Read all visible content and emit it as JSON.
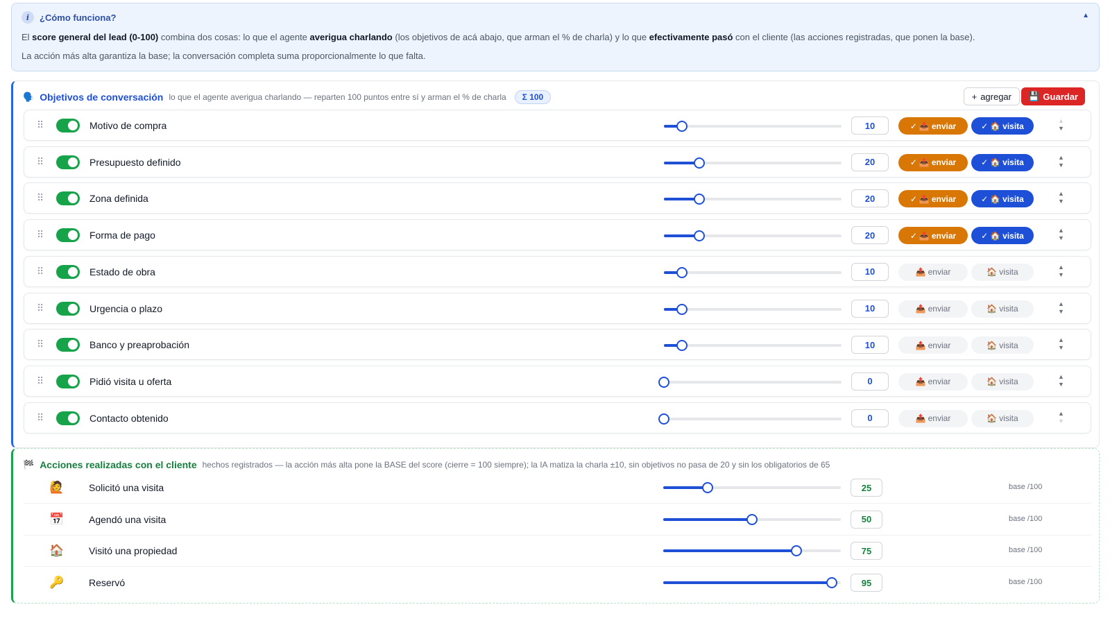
{
  "info": {
    "title": "¿Cómo funciona?",
    "line1": [
      {
        "t": "El ",
        "b": false
      },
      {
        "t": "score general del lead (0-100)",
        "b": true
      },
      {
        "t": " combina dos cosas: lo que el agente ",
        "b": false
      },
      {
        "t": "averigua charlando",
        "b": true
      },
      {
        "t": " (los objetivos de acá abajo, que arman el % de charla) y lo que ",
        "b": false
      },
      {
        "t": "efectivamente pasó",
        "b": true
      },
      {
        "t": " con el cliente (las acciones registradas, que ponen la base).",
        "b": false
      }
    ],
    "line2": "La acción más alta garantiza la base; la conversación completa suma proporcionalmente lo que falta."
  },
  "objectives": {
    "title": "Objetivos de conversación",
    "subtitle": "lo que el agente averigua charlando — reparten 100 puntos entre sí y arman el % de charla",
    "sum": "Σ 100",
    "add_label": "agregar",
    "save_label": "Guardar",
    "max": 100,
    "rows": [
      {
        "label": "Motivo de compra",
        "value": 10,
        "enviar": true,
        "visita": true
      },
      {
        "label": "Presupuesto definido",
        "value": 20,
        "enviar": true,
        "visita": true
      },
      {
        "label": "Zona definida",
        "value": 20,
        "enviar": true,
        "visita": true
      },
      {
        "label": "Forma de pago",
        "value": 20,
        "enviar": true,
        "visita": true
      },
      {
        "label": "Estado de obra",
        "value": 10,
        "enviar": false,
        "visita": false
      },
      {
        "label": "Urgencia o plazo",
        "value": 10,
        "enviar": false,
        "visita": false
      },
      {
        "label": "Banco y preaprobación",
        "value": 10,
        "enviar": false,
        "visita": false
      },
      {
        "label": "Pidió visita u oferta",
        "value": 0,
        "enviar": false,
        "visita": false
      },
      {
        "label": "Contacto obtenido",
        "value": 0,
        "enviar": false,
        "visita": false
      }
    ],
    "chip_enviar": "enviar",
    "chip_visita": "visita"
  },
  "actions": {
    "title": "Acciones realizadas con el cliente",
    "subtitle": "hechos registrados — la acción más alta pone la BASE del score (cierre = 100 siempre); la IA matiza la charla ±10, sin objetivos no pasa de 20 y sin los obligatorios de 65",
    "base_label": "base /100",
    "max": 100,
    "rows": [
      {
        "icon": "🙋",
        "icon_name": "raising-hand-icon",
        "label": "Solicitó una visita",
        "value": 25
      },
      {
        "icon": "📅",
        "icon_name": "calendar-icon",
        "label": "Agendó una visita",
        "value": 50
      },
      {
        "icon": "🏠",
        "icon_name": "house-icon",
        "label": "Visitó una propiedad",
        "value": 75
      },
      {
        "icon": "🔑",
        "icon_name": "key-icon",
        "label": "Reservó",
        "value": 95
      }
    ]
  },
  "colors": {
    "blue": "#1d4fd7",
    "orange": "#d97706",
    "green": "#16a34a",
    "red": "#dc2626"
  }
}
